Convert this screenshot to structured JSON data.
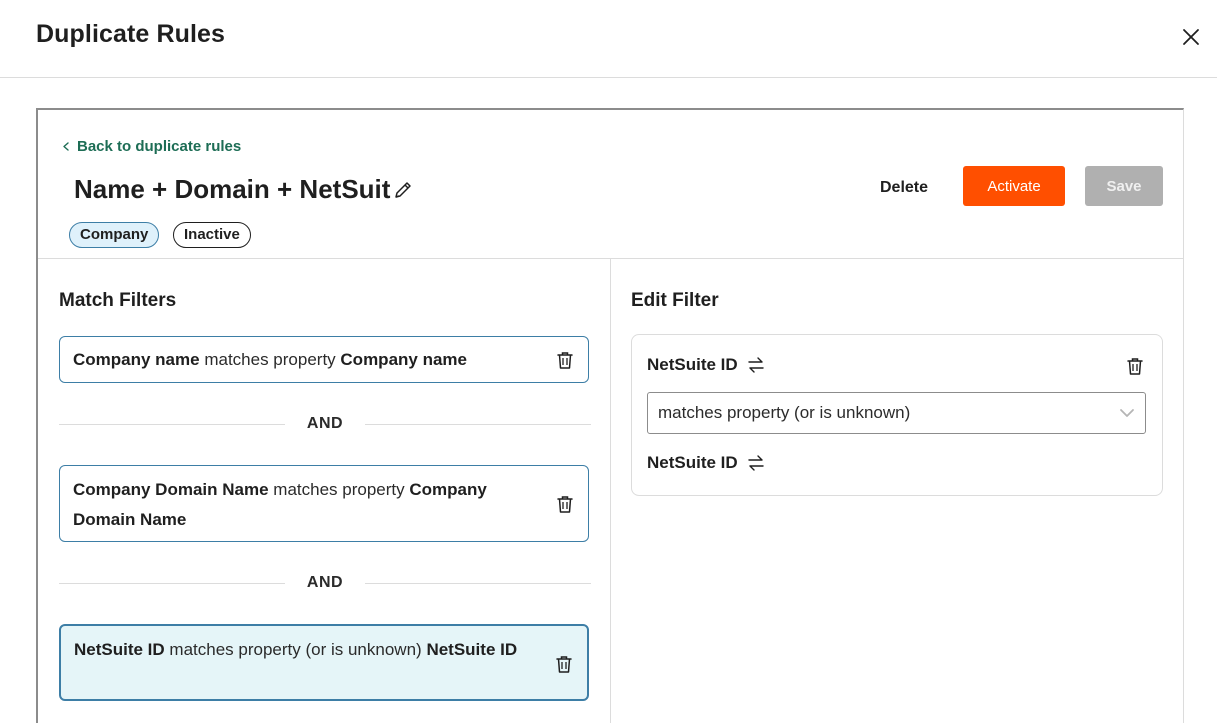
{
  "header": {
    "title": "Duplicate Rules"
  },
  "panel": {
    "back_link": "Back to duplicate rules",
    "rule_title": "Name + Domain + NetSuit",
    "tags": {
      "object": "Company",
      "status": "Inactive"
    },
    "actions": {
      "delete_label": "Delete",
      "activate_label": "Activate",
      "save_label": "Save"
    }
  },
  "match_filters": {
    "title": "Match Filters",
    "filters": [
      {
        "property": "Company name",
        "operator": "matches property",
        "target": "Company name"
      },
      {
        "property": "Company Domain Name",
        "operator": "matches property",
        "target": "Company Domain Name"
      },
      {
        "property": "NetSuite ID",
        "operator": "matches property (or is unknown)",
        "target": "NetSuite ID"
      }
    ],
    "connector": "AND"
  },
  "edit_filter": {
    "title": "Edit Filter",
    "source_property": "NetSuite ID",
    "operator_selected": "matches property (or is unknown)",
    "target_property": "NetSuite ID"
  },
  "icons": {
    "close": "close-icon",
    "back": "chevron-left-icon",
    "edit": "pencil-icon",
    "delete": "trash-icon",
    "swap": "swap-arrows-icon",
    "dropdown": "chevron-down-icon"
  },
  "colors": {
    "accent_orange": "#ff4f00",
    "link_green": "#1d6d55",
    "selected_bg": "#e5f5f8",
    "card_border": "#3d7ea6",
    "disabled_gray": "#b0b0b0"
  }
}
